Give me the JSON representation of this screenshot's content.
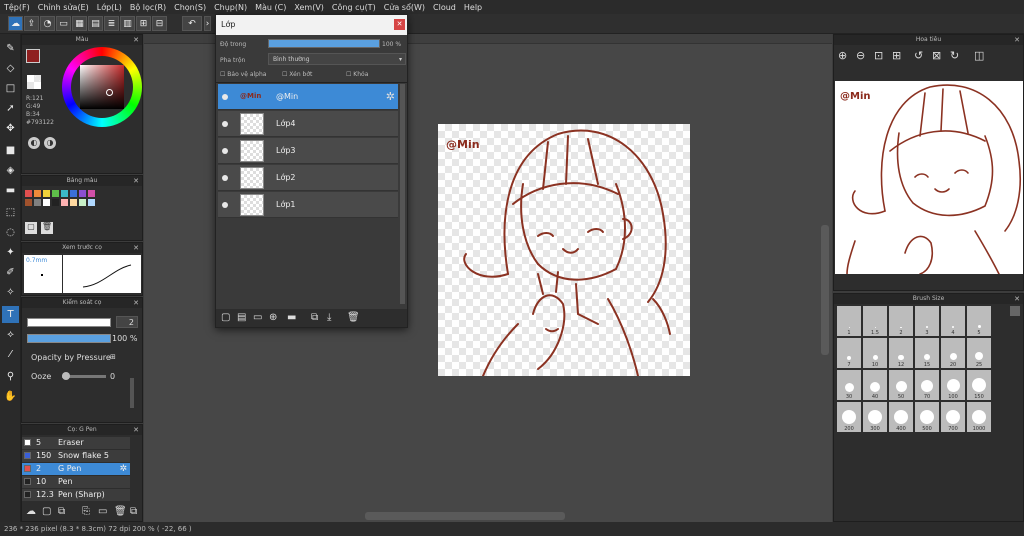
{
  "menu": [
    "Tệp(F)",
    "Chỉnh sửa(E)",
    "Lớp(L)",
    "Bộ lọc(R)",
    "Chọn(S)",
    "Chụp(N)",
    "Màu (C)",
    "Xem(V)",
    "Công cụ(T)",
    "Cửa sổ(W)",
    "Cloud",
    "Help"
  ],
  "color_panel": {
    "title": "Màu",
    "r": "R:121",
    "g": "G:49",
    "b": "B:34",
    "hex": "#793122",
    "primary": "#8f1f1f"
  },
  "palette_panel": {
    "title": "Bảng màu",
    "swatches": [
      "#e14f4f",
      "#f08a3a",
      "#f2d23a",
      "#5fc04a",
      "#3bb8c8",
      "#3a6fd8",
      "#8a4fd0",
      "#d04fa8",
      "#a0522d",
      "#808080",
      "#ffffff",
      "#222222",
      "#ffb3b3",
      "#ffd9a0",
      "#c8f0c8",
      "#b0d8ff"
    ]
  },
  "preview_panel": {
    "title": "Xem trước cọ",
    "size": "0.7mm"
  },
  "control_panel": {
    "title": "Kiểm soát cọ",
    "size": "2",
    "opacity": "100 %",
    "opacity_pressure": "Opacity by Pressure",
    "ooze_label": "Ooze",
    "ooze_value": "0"
  },
  "brush_panel": {
    "title": "Cọ: G Pen",
    "items": [
      {
        "size": "5",
        "name": "Eraser",
        "color": "#ffffff"
      },
      {
        "size": "150",
        "name": "Snow flake 5",
        "color": "#3a5fd8"
      },
      {
        "size": "2",
        "name": "G Pen",
        "color": "#e14f4f",
        "selected": true
      },
      {
        "size": "10",
        "name": "Pen",
        "color": "#222222"
      },
      {
        "size": "12.3",
        "name": "Pen (Sharp)",
        "color": "#222222"
      }
    ]
  },
  "layer_window": {
    "title": "Lớp",
    "opacity_label": "Độ trong",
    "opacity_value": "100 %",
    "blend_label": "Pha trộn",
    "blend_value": "Bình thường",
    "protect_alpha": "Bảo vệ alpha",
    "clipping": "Xén bớt",
    "lock": "Khóa",
    "layers": [
      "@Min",
      "Lớp4",
      "Lớp3",
      "Lớp2",
      "Lớp1"
    ]
  },
  "canvas": {
    "watermark": "@Min"
  },
  "navigator": {
    "title": "Hoa tiêu",
    "watermark": "@Min"
  },
  "brush_size": {
    "title": "Brush Size",
    "sizes": [
      "1",
      "1.5",
      "2",
      "3",
      "4",
      "5",
      "7",
      "10",
      "12",
      "15",
      "20",
      "25",
      "30",
      "40",
      "50",
      "70",
      "100",
      "150",
      "200",
      "300",
      "400",
      "500",
      "700",
      "1000"
    ]
  },
  "status": "236 * 236 pixel   (8.3 * 8.3cm)   72 dpi   200 %   ( -22, 66 )"
}
